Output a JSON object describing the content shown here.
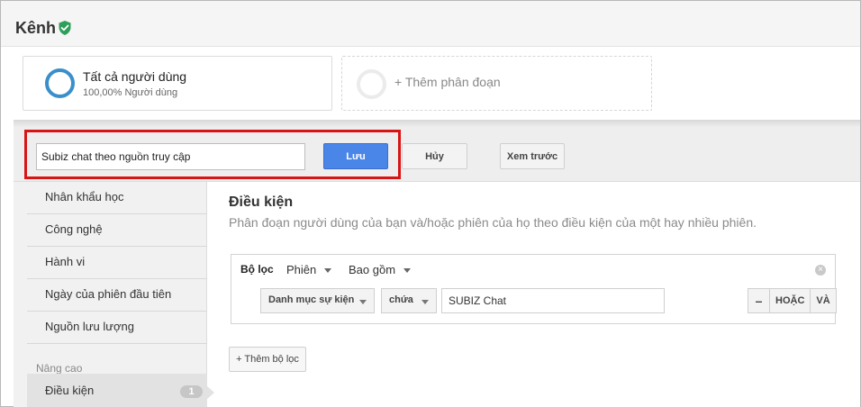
{
  "page": {
    "title": "Kênh"
  },
  "segments": {
    "primary": {
      "name": "Tất cả người dùng",
      "subtitle": "100,00% Người dùng"
    },
    "add_label": "+ Thêm phân đoạn"
  },
  "toolbar": {
    "segment_name_value": "Subiz chat theo nguồn truy cập",
    "save_label": "Lưu",
    "cancel_label": "Hủy",
    "preview_label": "Xem trước"
  },
  "sidebar": {
    "items": [
      {
        "label": "Nhân khẩu học"
      },
      {
        "label": "Công nghệ"
      },
      {
        "label": "Hành vi"
      },
      {
        "label": "Ngày của phiên đầu tiên"
      },
      {
        "label": "Nguồn lưu lượng"
      }
    ],
    "section_label": "Nâng cao",
    "active": {
      "label": "Điều kiện",
      "count": "1"
    }
  },
  "conditions": {
    "title": "Điều kiện",
    "description": "Phân đoạn người dùng của bạn và/hoặc phiên của họ theo điều kiện của một hay nhiều phiên.",
    "filter": {
      "label": "Bộ lọc",
      "scope": "Phiên",
      "include": "Bao gồm",
      "dimension": "Danh mục sự kiện",
      "operator": "chứa",
      "value": "SUBIZ Chat",
      "minus": "–",
      "or": "HOẶC",
      "and": "VÀ"
    },
    "add_filter_label": "+ Thêm bộ lọc"
  },
  "colors": {
    "accent": "#4a86e8",
    "highlight": "#d81515",
    "ring": "#3a8fca",
    "verified": "#2e9e5b"
  }
}
